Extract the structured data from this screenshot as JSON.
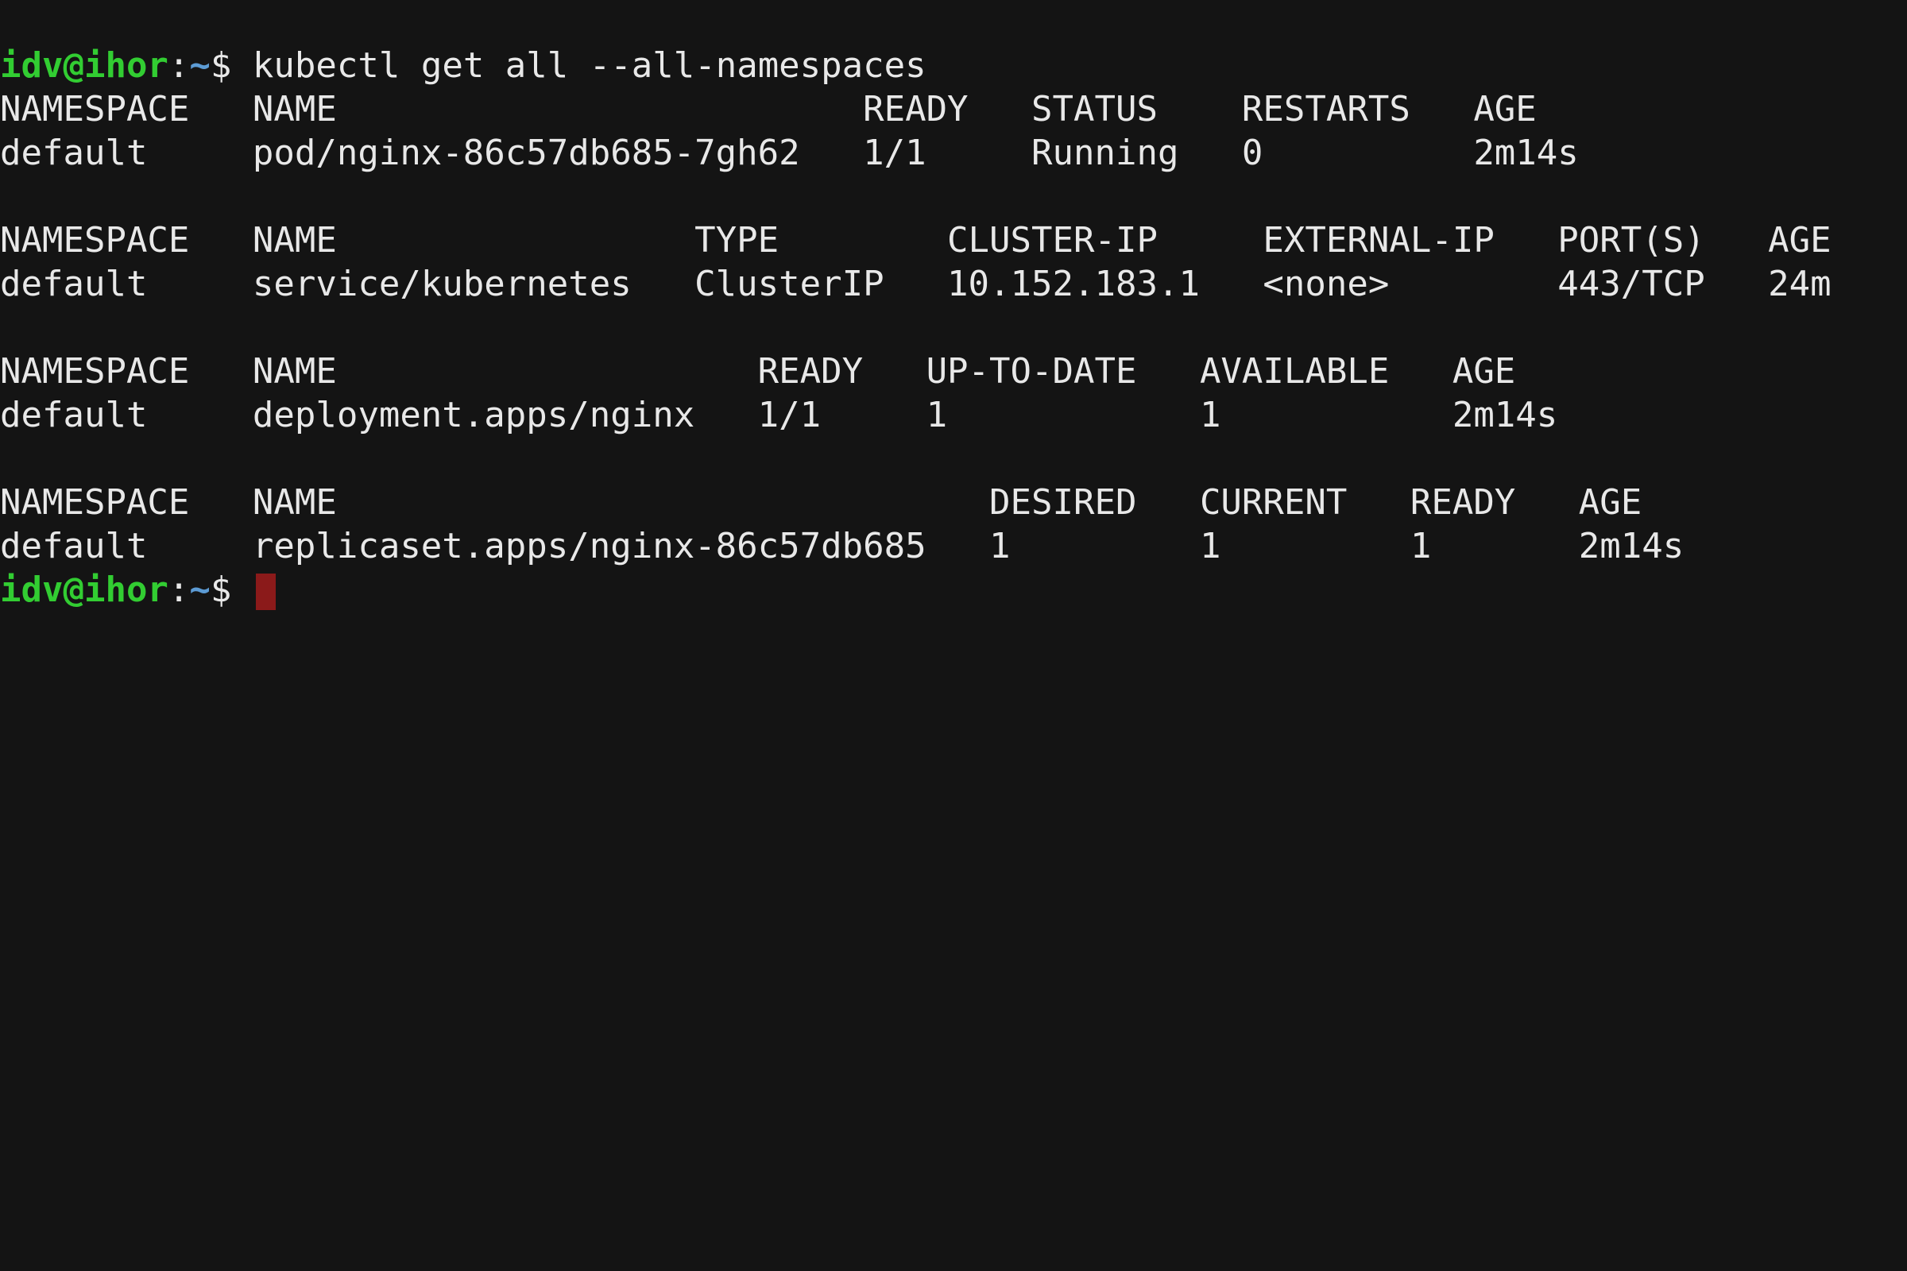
{
  "prompt": {
    "user": "idv@ihor",
    "sep1": ":",
    "path": "~",
    "sep2": "$",
    "space": " "
  },
  "command": "kubectl get all --all-namespaces",
  "blank": "",
  "pods": {
    "header": "NAMESPACE   NAME                         READY   STATUS    RESTARTS   AGE",
    "rows": [
      "default     pod/nginx-86c57db685-7gh62   1/1     Running   0          2m14s"
    ]
  },
  "services": {
    "header": "NAMESPACE   NAME                 TYPE        CLUSTER-IP     EXTERNAL-IP   PORT(S)   AGE",
    "rows": [
      "default     service/kubernetes   ClusterIP   10.152.183.1   <none>        443/TCP   24m"
    ]
  },
  "deployments": {
    "header": "NAMESPACE   NAME                    READY   UP-TO-DATE   AVAILABLE   AGE",
    "rows": [
      "default     deployment.apps/nginx   1/1     1            1           2m14s"
    ]
  },
  "replicasets": {
    "header": "NAMESPACE   NAME                               DESIRED   CURRENT   READY   AGE",
    "rows": [
      "default     replicaset.apps/nginx-86c57db685   1         1         1       2m14s"
    ]
  }
}
